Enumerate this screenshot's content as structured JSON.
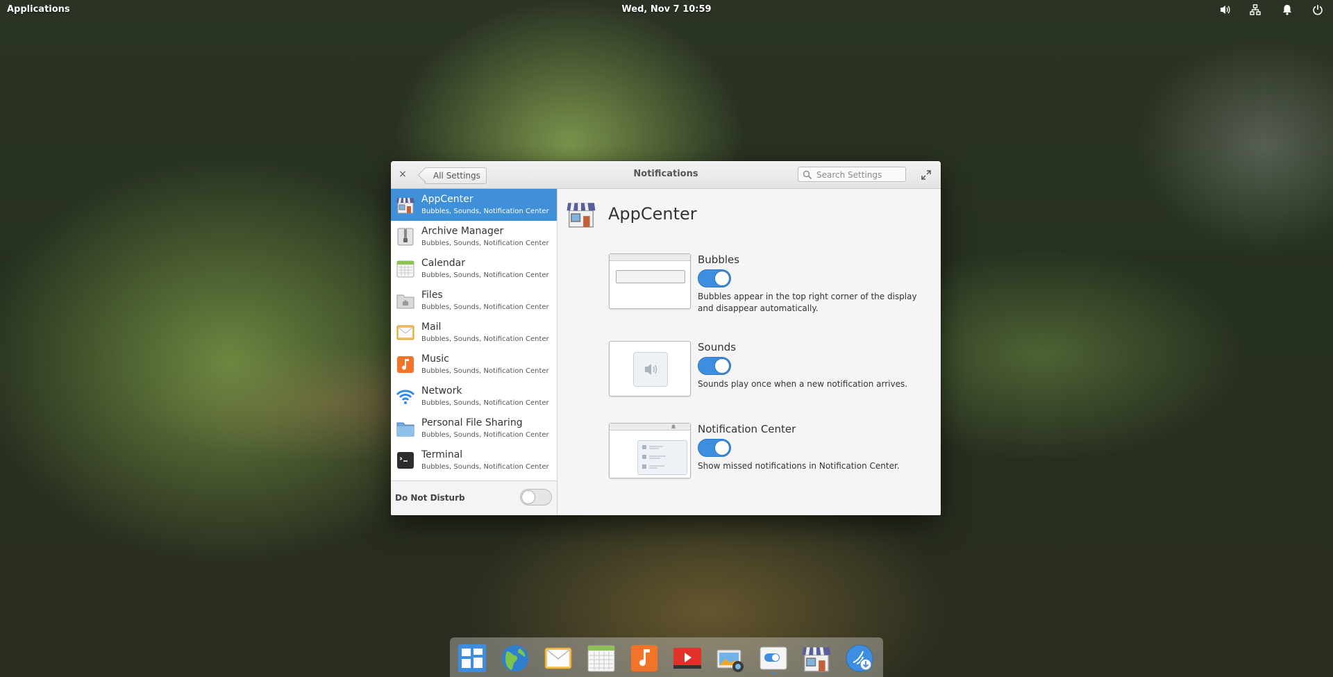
{
  "panel": {
    "applications": "Applications",
    "clock": "Wed, Nov  7   10:59",
    "indicators": [
      "volume-icon",
      "network-icon",
      "notifications-icon",
      "power-icon"
    ]
  },
  "window": {
    "close_glyph": "×",
    "back_label": "All Settings",
    "title": "Notifications",
    "search_placeholder": "Search Settings"
  },
  "sidebar": {
    "apps": [
      {
        "name": "AppCenter",
        "desc": "Bubbles, Sounds, Notification Center",
        "icon": "appcenter-icon",
        "selected": true
      },
      {
        "name": "Archive Manager",
        "desc": "Bubbles, Sounds, Notification Center",
        "icon": "archive-manager-icon"
      },
      {
        "name": "Calendar",
        "desc": "Bubbles, Sounds, Notification Center",
        "icon": "calendar-icon"
      },
      {
        "name": "Files",
        "desc": "Bubbles, Sounds, Notification Center",
        "icon": "files-icon"
      },
      {
        "name": "Mail",
        "desc": "Bubbles, Sounds, Notification Center",
        "icon": "mail-icon"
      },
      {
        "name": "Music",
        "desc": "Bubbles, Sounds, Notification Center",
        "icon": "music-icon"
      },
      {
        "name": "Network",
        "desc": "Bubbles, Sounds, Notification Center",
        "icon": "network-wifi-icon"
      },
      {
        "name": "Personal File Sharing",
        "desc": "Bubbles, Sounds, Notification Center",
        "icon": "file-sharing-icon"
      },
      {
        "name": "Terminal",
        "desc": "Bubbles, Sounds, Notification Center",
        "icon": "terminal-icon"
      }
    ],
    "dnd_label": "Do Not Disturb",
    "dnd_enabled": false
  },
  "main": {
    "app_title": "AppCenter",
    "options": [
      {
        "title": "Bubbles",
        "enabled": true,
        "desc": "Bubbles appear in the top right corner of the display and disappear automatically."
      },
      {
        "title": "Sounds",
        "enabled": true,
        "desc": "Sounds play once when a new notification arrives."
      },
      {
        "title": "Notification Center",
        "enabled": true,
        "desc": "Show missed notifications in Notification Center."
      }
    ]
  },
  "dock": {
    "items": [
      "multitasking-view-icon",
      "web-browser-icon",
      "mail-icon",
      "calendar-icon",
      "music-icon",
      "videos-icon",
      "photos-icon",
      "system-settings-icon",
      "appcenter-icon",
      "installer-icon"
    ]
  },
  "colors": {
    "accent": "#3f8fd9",
    "switch_on": "#3d8ee0"
  }
}
